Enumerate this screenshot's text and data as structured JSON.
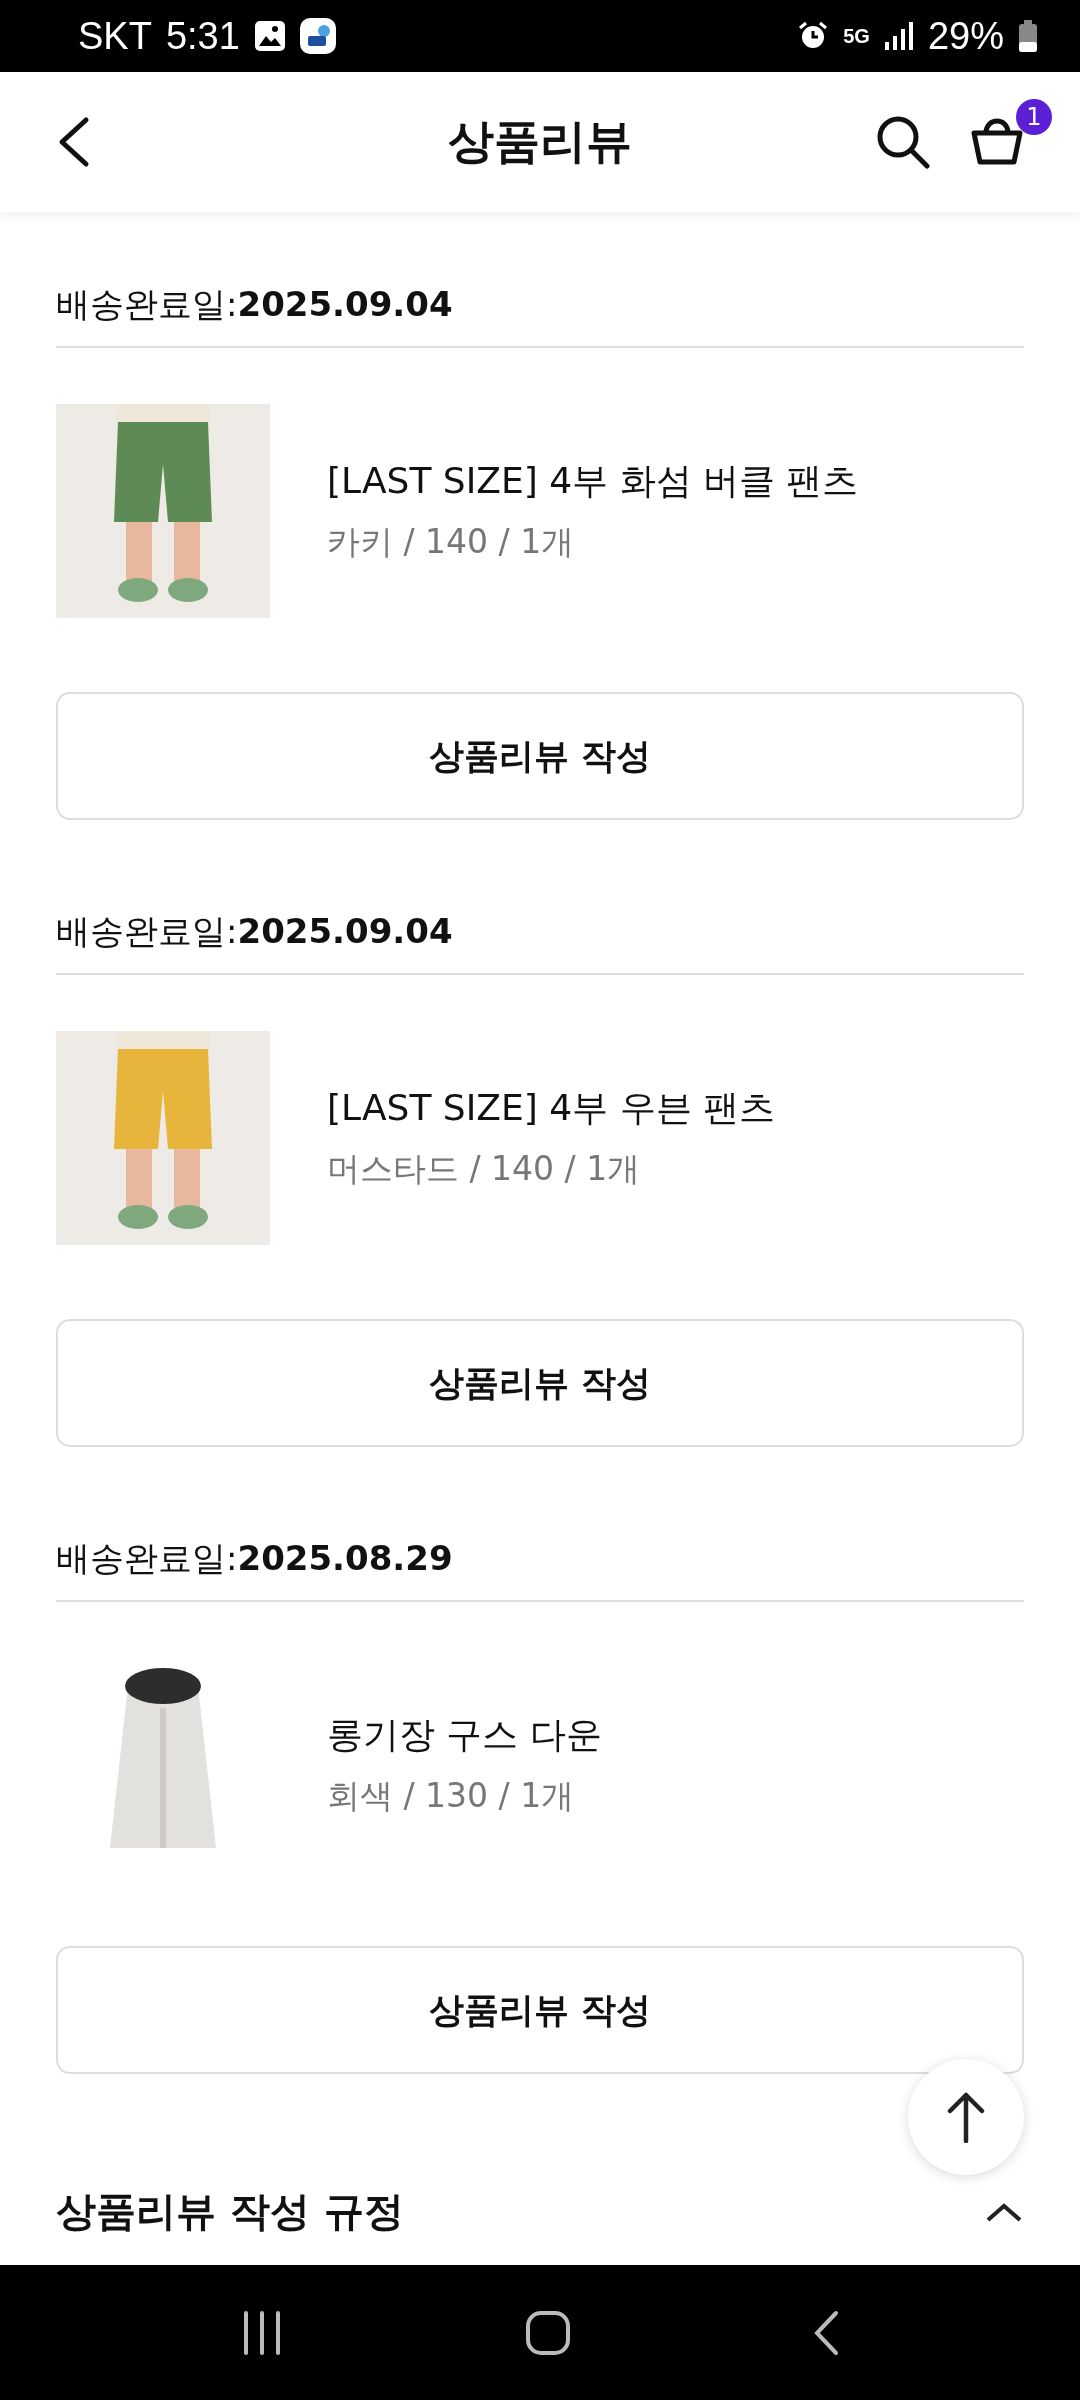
{
  "status_bar": {
    "carrier": "SKT",
    "time": "5:31",
    "network": "5G",
    "battery": "29%"
  },
  "header": {
    "title": "상품리뷰",
    "cart_count": "1"
  },
  "orders": [
    {
      "delivered": "배송완료일:**2025.09.04**",
      "product_name": "[LAST SIZE] 4부 화섬 버클 팬츠",
      "option": "카키 / 140 / 1개",
      "button": "상품리뷰 작성"
    },
    {
      "delivered": "배송완료일:**2025.09.04**",
      "product_name": "[LAST SIZE] 4부 우븐 팬츠",
      "option": "머스타드 / 140 / 1개",
      "button": "상품리뷰 작성"
    },
    {
      "delivered": "배송완료일:**2025.08.29**",
      "product_name": "롱기장 구스 다운",
      "option": "회색 / 130 / 1개",
      "button": "상품리뷰 작성"
    }
  ],
  "guide_title": "상품리뷰 작성 규정"
}
